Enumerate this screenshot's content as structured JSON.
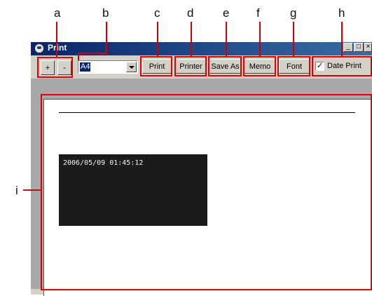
{
  "callouts": {
    "a": "a",
    "b": "b",
    "c": "c",
    "d": "d",
    "e": "e",
    "f": "f",
    "g": "g",
    "h": "h",
    "i": "i"
  },
  "window": {
    "title": "Print",
    "controls": {
      "minimize": "_",
      "maximize": "□",
      "close": "×"
    }
  },
  "toolbar": {
    "zoom_in": "+",
    "zoom_out": "-",
    "paper_size": "A4",
    "print": "Print",
    "printer": "Printer",
    "save_as": "Save As",
    "memo": "Memo",
    "font": "Font",
    "date_print_label": "Date Print",
    "date_print_checked": "✓"
  },
  "preview": {
    "timestamp": "2006/05/09 01:45:12"
  },
  "colors": {
    "callout_red": "#e00000",
    "titlebar_start": "#0a246a",
    "titlebar_end": "#3a6ea5",
    "dialog_face": "#d4d0c8"
  }
}
